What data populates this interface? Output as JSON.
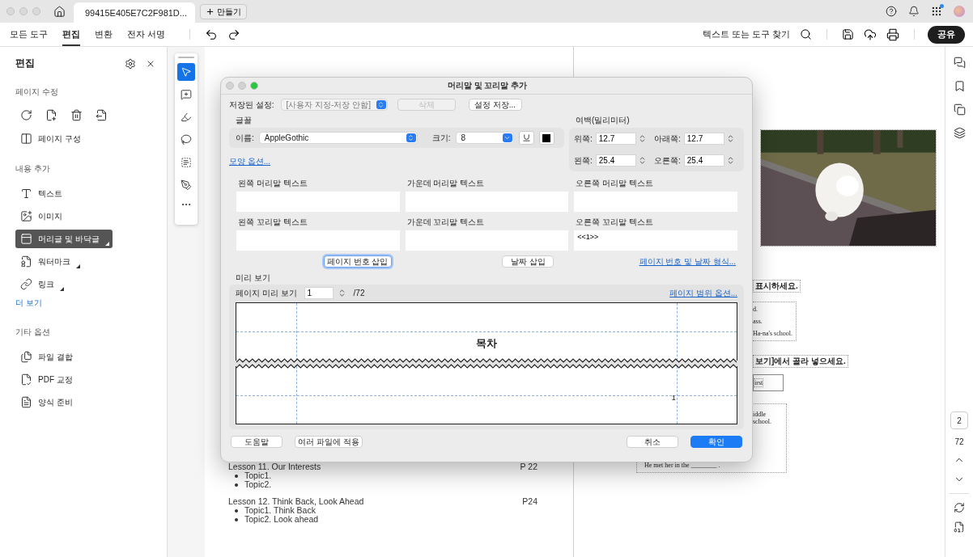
{
  "browser_tab": {
    "title": "99415E405E7C2F981D...",
    "new_button": "만들기"
  },
  "toolbar": {
    "tabs": [
      {
        "label": "모든 도구",
        "selected": false
      },
      {
        "label": "편집",
        "selected": true
      },
      {
        "label": "변환",
        "selected": false
      },
      {
        "label": "전자 서명",
        "selected": false
      }
    ],
    "search_hint": "텍스트 또는 도구 찾기",
    "share_button": "공유"
  },
  "edit_panel": {
    "title": "편집",
    "sections": [
      {
        "heading": "페이지 수정",
        "items": [
          {
            "label": "페이지 구성",
            "selected": false,
            "flyout": false
          }
        ]
      },
      {
        "heading": "내용 추가",
        "items": [
          {
            "label": "텍스트",
            "selected": false,
            "flyout": false
          },
          {
            "label": "이미지",
            "selected": false,
            "flyout": false
          },
          {
            "label": "머리글 및 바닥글",
            "selected": true,
            "flyout": true
          },
          {
            "label": "워터마크",
            "selected": false,
            "flyout": true
          },
          {
            "label": "링크",
            "selected": false,
            "flyout": true
          }
        ],
        "more_link": "더 보기"
      },
      {
        "heading": "기타 옵션",
        "items": [
          {
            "label": "파일 결합",
            "selected": false,
            "flyout": false
          },
          {
            "label": "PDF 교정",
            "selected": false,
            "flyout": false
          },
          {
            "label": "양식 준비",
            "selected": false,
            "flyout": false
          }
        ]
      }
    ]
  },
  "tool_strip": {
    "tools": [
      {
        "selected": true
      },
      {
        "selected": false
      },
      {
        "selected": false
      },
      {
        "selected": false
      },
      {
        "selected": false
      },
      {
        "selected": false
      }
    ]
  },
  "document": {
    "left_page": {
      "lessons": [
        {
          "title": "Lesson 11. Our Interests",
          "page": "P 22",
          "topics": [
            "Topic1.",
            "Topic2."
          ]
        },
        {
          "title": "Lesson 12. Think Back, Look Ahead",
          "page": "P24",
          "topics": [
            "Topic1. Think Back",
            "Topic2. Look ahead"
          ]
        }
      ]
    },
    "right_page": {
      "picture": {
        "kind": "picture"
      },
      "instruction_1": "표시하세요.",
      "box_1_lines": [
        "d.",
        "ass.",
        "Ha-na's school."
      ],
      "instruction_2": "보기]에서 골라 넣으세요.",
      "answer_blank": "irst",
      "box_2_top": "iddle school.",
      "box_2_bottom": "He met her in the ________ ."
    }
  },
  "page_nav": {
    "current_page": "2",
    "page_count": "72"
  },
  "dialog": {
    "title": "머리말 및 꼬리말 추가",
    "saved_settings": {
      "label": "저장된 설정:",
      "value": "[사용자 지정-저장 안함]",
      "disabled": true
    },
    "delete_button": {
      "label": "삭제",
      "disabled": true
    },
    "save_settings_button": {
      "label": "설정 저장...",
      "disabled": false
    },
    "font": {
      "heading": "글꼴",
      "name_label": "이름:",
      "name": "AppleGothic",
      "size_label": "크기:",
      "size": "8"
    },
    "appearance_link": "모양 옵션...",
    "margins": {
      "heading": "여백(밀리미터)",
      "fields": [
        {
          "label": "위쪽:",
          "value": "12.7"
        },
        {
          "label": "아래쪽:",
          "value": "12.7"
        },
        {
          "label": "왼쪽:",
          "value": "25.4"
        },
        {
          "label": "오른쪽:",
          "value": "25.4"
        }
      ]
    },
    "text_fields": [
      {
        "label": "왼쪽 머리말 텍스트"
      },
      {
        "label": "가운데 머리말 텍스트"
      },
      {
        "label": "오른쪽 머리말 텍스트"
      },
      {
        "label": "왼쪽 꼬리말 텍스트"
      },
      {
        "label": "가운데 꼬리말 텍스트"
      },
      {
        "label": "오른쪽 꼬리말 텍스트",
        "value": "<<1>>"
      }
    ],
    "insert_buttons": [
      {
        "label": "페이지 번호 삽입",
        "focused": true
      },
      {
        "label": "날짜 삽입",
        "focused": false
      }
    ],
    "format_link": "페이지 번호 및 날짜 형식...",
    "preview": {
      "heading": "미리 보기",
      "page_label": "페이지 미리 보기",
      "page": "1",
      "total": "/72",
      "range_link": "페이지 범위 옵션...",
      "header_sample": "목차",
      "footer_sample": "1"
    },
    "footer_buttons_start": [
      {
        "label": "도움말",
        "default": false
      },
      {
        "label": "여러 파일에 적용",
        "default": false
      }
    ],
    "footer_buttons_end": [
      {
        "label": "취소",
        "default": false
      },
      {
        "label": "확인",
        "default": true
      }
    ]
  }
}
